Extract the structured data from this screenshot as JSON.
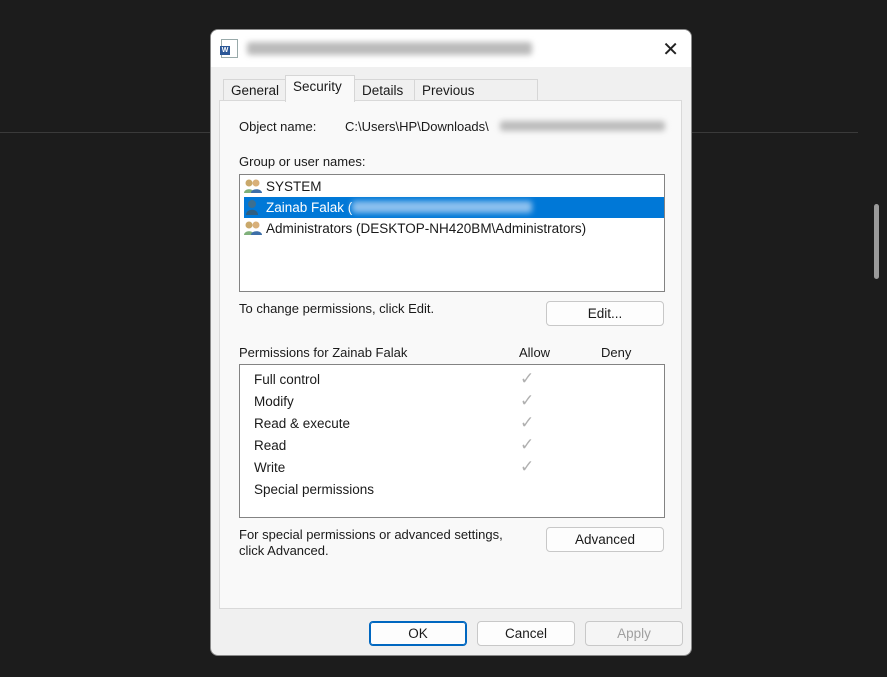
{
  "dialog": {
    "close_icon": "close-icon",
    "app_icon": "word-document-icon"
  },
  "tabs": [
    {
      "label": "General"
    },
    {
      "label": "Security",
      "active": true
    },
    {
      "label": "Details"
    },
    {
      "label": "Previous Versions"
    }
  ],
  "security": {
    "object_name_label": "Object name:",
    "object_name_value": "C:\\Users\\HP\\Downloads\\",
    "group_label": "Group or user names:",
    "users": [
      {
        "name": "SYSTEM",
        "icon": "group-icon"
      },
      {
        "name": "Zainab Falak (",
        "icon": "user-icon",
        "selected": true
      },
      {
        "name": "Administrators (DESKTOP-NH420BM\\Administrators)",
        "icon": "group-icon"
      }
    ],
    "change_hint": "To change permissions, click Edit.",
    "edit_label": "Edit...",
    "permissions_label": "Permissions for Zainab Falak",
    "allow_label": "Allow",
    "deny_label": "Deny",
    "permissions": [
      {
        "name": "Full control",
        "allow": true,
        "deny": false
      },
      {
        "name": "Modify",
        "allow": true,
        "deny": false
      },
      {
        "name": "Read & execute",
        "allow": true,
        "deny": false
      },
      {
        "name": "Read",
        "allow": true,
        "deny": false
      },
      {
        "name": "Write",
        "allow": true,
        "deny": false
      },
      {
        "name": "Special permissions",
        "allow": false,
        "deny": false
      }
    ],
    "check_glyph": "✓",
    "advanced_hint_1": "For special permissions or advanced settings,",
    "advanced_hint_2": "click Advanced.",
    "advanced_label": "Advanced"
  },
  "footer": {
    "ok": "OK",
    "cancel": "Cancel",
    "apply": "Apply"
  },
  "colors": {
    "selection": "#0078d7",
    "accent": "#0067c0"
  }
}
